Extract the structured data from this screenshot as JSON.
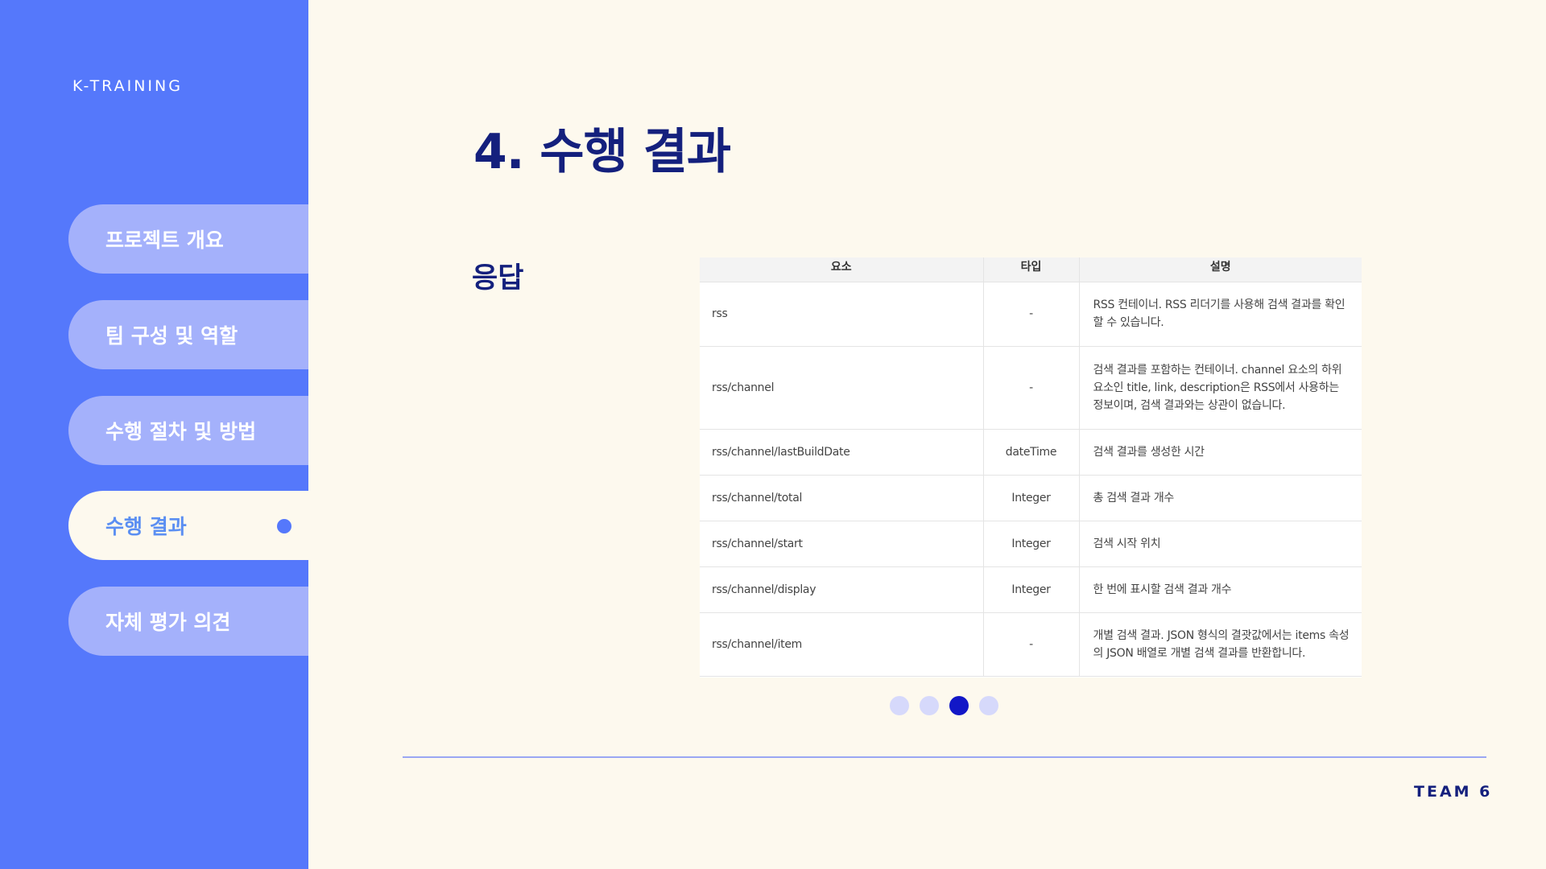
{
  "brand": "K-TRAINING",
  "nav": {
    "items": [
      {
        "label": "프로젝트 개요"
      },
      {
        "label": "팀 구성 및 역할"
      },
      {
        "label": "수행 절차 및 방법"
      },
      {
        "label": "수행 결과"
      },
      {
        "label": "자체 평가 의견"
      }
    ],
    "active_index": 3
  },
  "page": {
    "title": "4. 수행 결과",
    "section_label": "응답"
  },
  "table": {
    "headers": [
      "요소",
      "타입",
      "설명"
    ],
    "rows": [
      {
        "element": "rss",
        "type": "-",
        "description": "RSS 컨테이너. RSS 리더기를 사용해 검색 결과를 확인할 수 있습니다."
      },
      {
        "element": "rss/channel",
        "type": "-",
        "description": "검색 결과를 포함하는 컨테이너. channel 요소의 하위 요소인 title, link, description은 RSS에서 사용하는 정보이며, 검색 결과와는 상관이 없습니다."
      },
      {
        "element": "rss/channel/lastBuildDate",
        "type": "dateTime",
        "description": "검색 결과를 생성한 시간"
      },
      {
        "element": "rss/channel/total",
        "type": "Integer",
        "description": "총 검색 결과 개수"
      },
      {
        "element": "rss/channel/start",
        "type": "Integer",
        "description": "검색 시작 위치"
      },
      {
        "element": "rss/channel/display",
        "type": "Integer",
        "description": "한 번에 표시할 검색 결과 개수"
      },
      {
        "element": "rss/channel/item",
        "type": "-",
        "description": "개별 검색 결과. JSON 형식의 결괏값에서는 items 속성의 JSON 배열로 개별 검색 결과를 반환합니다."
      }
    ]
  },
  "pager": {
    "count": 4,
    "active_index": 2
  },
  "footer": {
    "team": "TEAM 6"
  },
  "colors": {
    "sidebar": "#5578fb",
    "nav_inactive": "#a4b1fb",
    "active_text": "#5b8ff2",
    "title": "#14207d",
    "background": "#fdf9ee",
    "pager_active": "#1217c7",
    "pager_inactive": "#d6d9fb"
  }
}
